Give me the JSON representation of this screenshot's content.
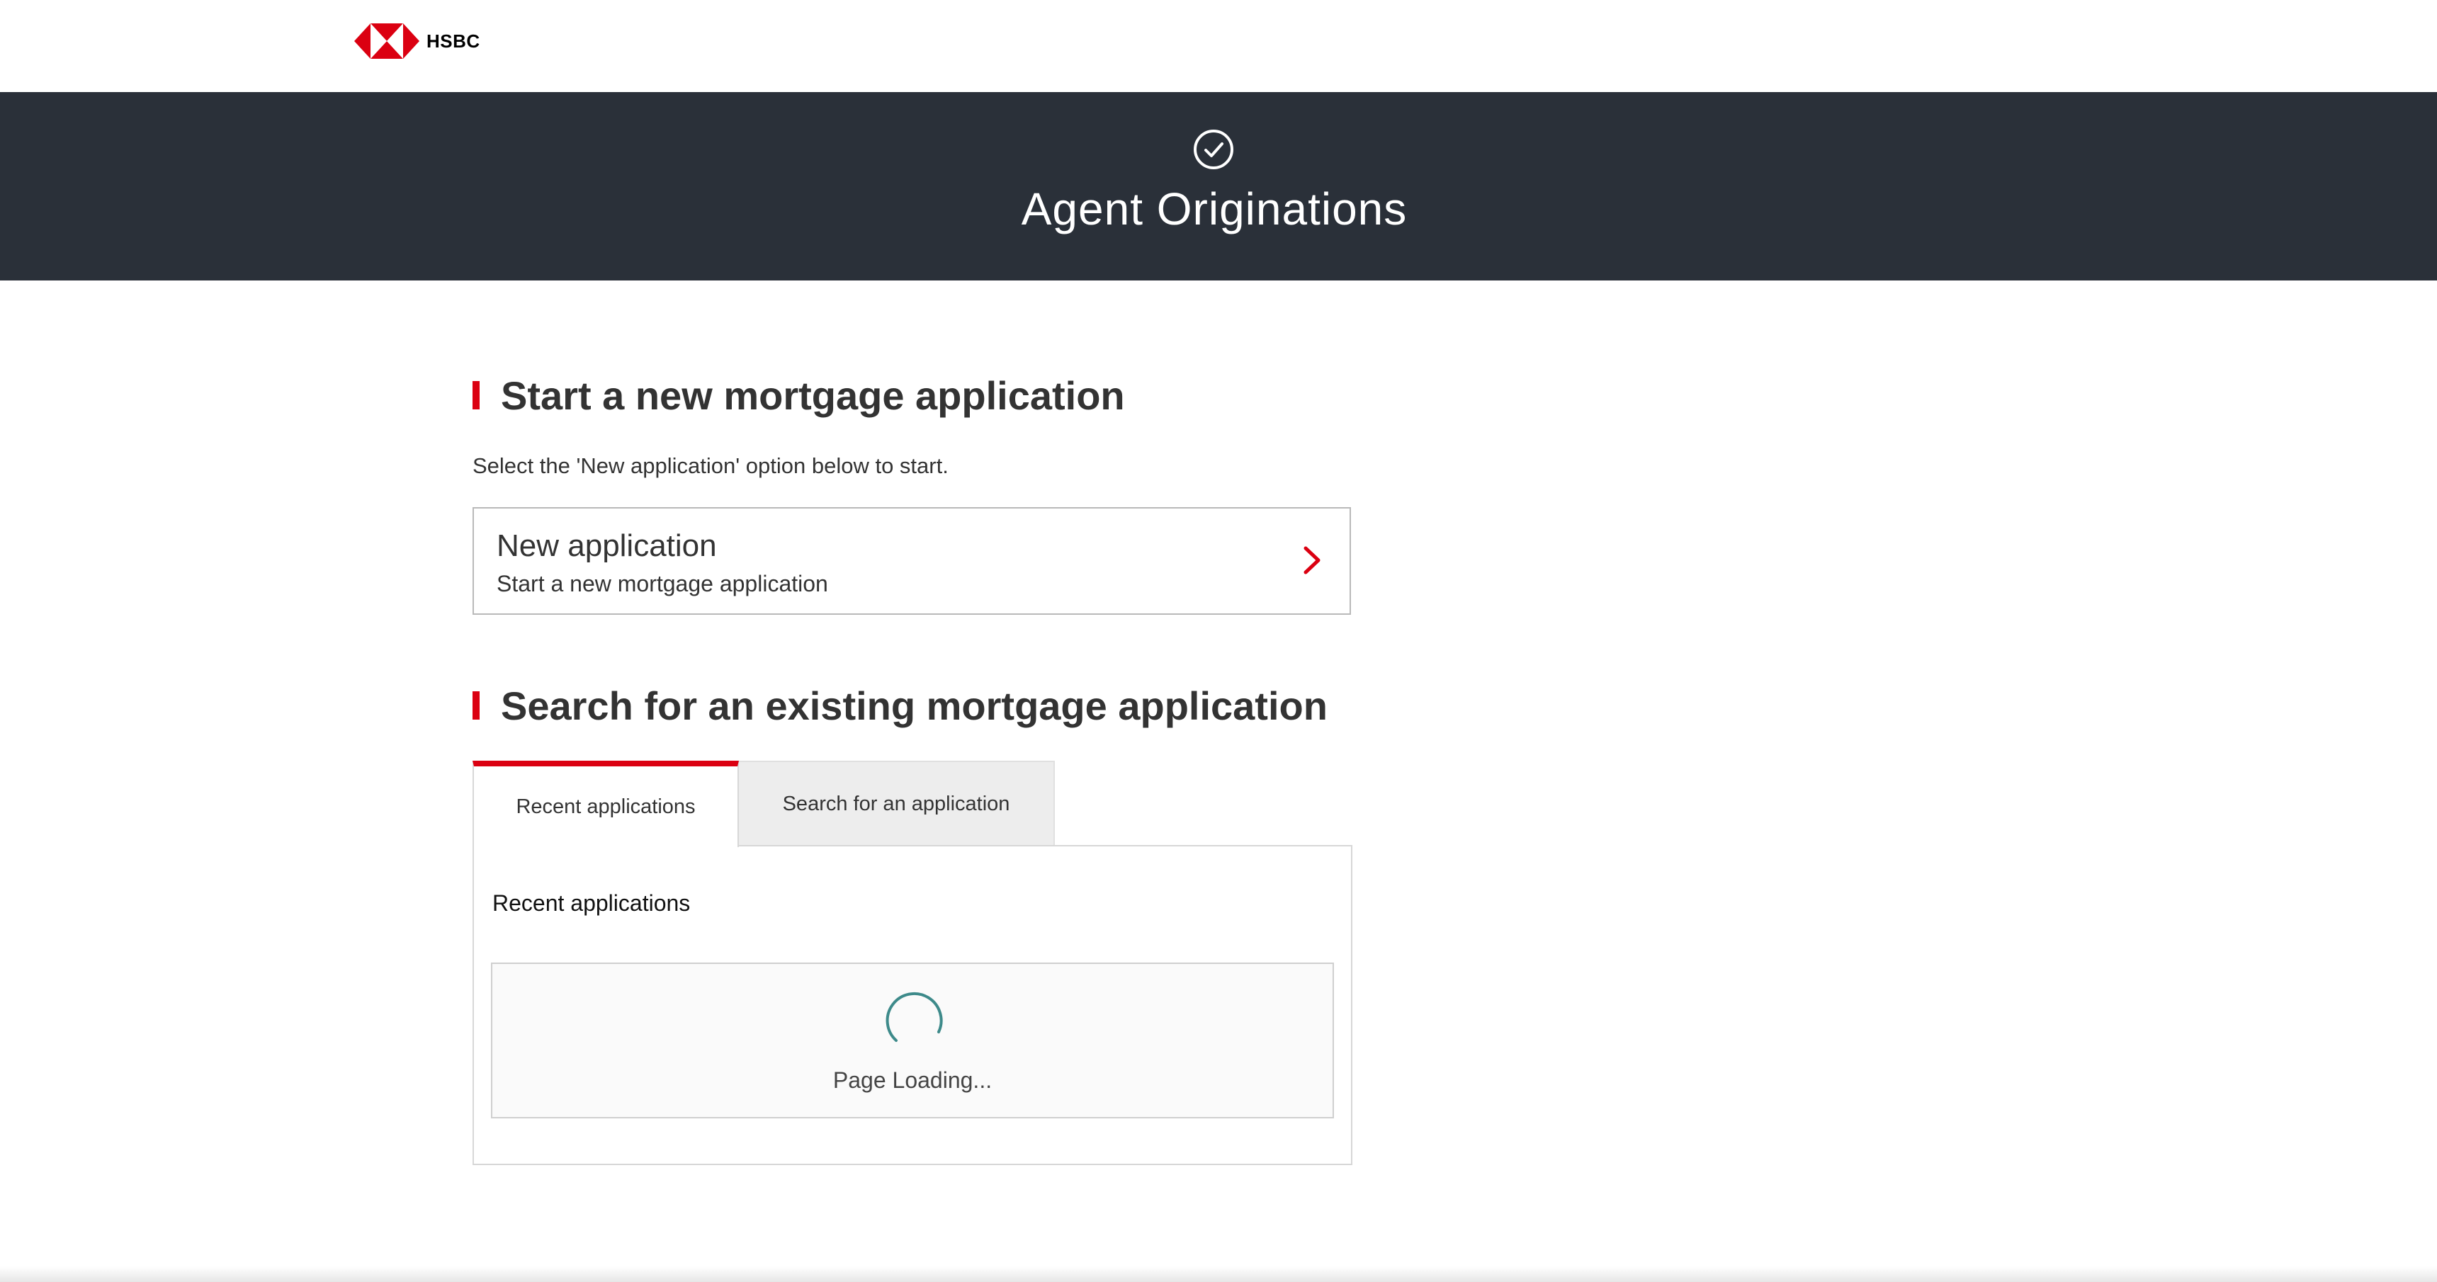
{
  "header": {
    "brand": "HSBC",
    "brand_colors": {
      "red": "#db0011",
      "banner": "#2a3039"
    }
  },
  "banner": {
    "icon": "check-circle-icon",
    "title": "Agent Originations"
  },
  "new_application_section": {
    "heading": "Start a new mortgage application",
    "intro": "Select the 'New application' option below to start.",
    "card": {
      "title": "New application",
      "subtitle": "Start a new mortgage application",
      "icon": "chevron-right-icon"
    }
  },
  "search_section": {
    "heading": "Search for an existing mortgage application",
    "tabs": [
      {
        "label": "Recent applications",
        "active": true
      },
      {
        "label": "Search for an application",
        "active": false
      }
    ],
    "panel": {
      "title": "Recent applications",
      "loading_text": "Page Loading...",
      "spinner_icon": "spinner-icon"
    }
  }
}
